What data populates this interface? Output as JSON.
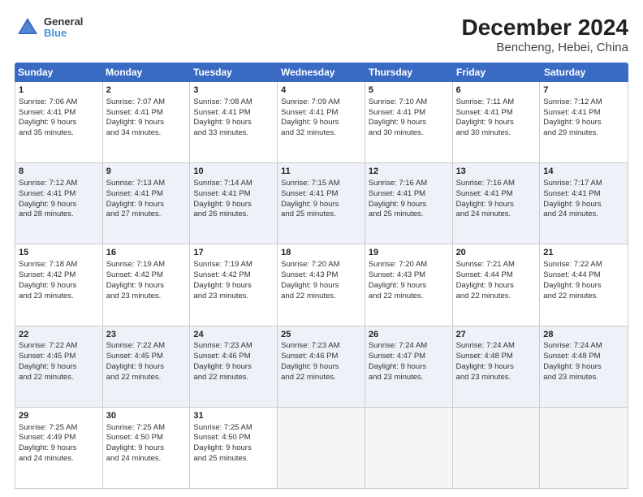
{
  "header": {
    "logo_line1": "General",
    "logo_line2": "Blue",
    "title": "December 2024",
    "subtitle": "Bencheng, Hebei, China"
  },
  "weekdays": [
    "Sunday",
    "Monday",
    "Tuesday",
    "Wednesday",
    "Thursday",
    "Friday",
    "Saturday"
  ],
  "rows": [
    [
      {
        "day": "1",
        "lines": [
          "Sunrise: 7:06 AM",
          "Sunset: 4:41 PM",
          "Daylight: 9 hours",
          "and 35 minutes."
        ]
      },
      {
        "day": "2",
        "lines": [
          "Sunrise: 7:07 AM",
          "Sunset: 4:41 PM",
          "Daylight: 9 hours",
          "and 34 minutes."
        ]
      },
      {
        "day": "3",
        "lines": [
          "Sunrise: 7:08 AM",
          "Sunset: 4:41 PM",
          "Daylight: 9 hours",
          "and 33 minutes."
        ]
      },
      {
        "day": "4",
        "lines": [
          "Sunrise: 7:09 AM",
          "Sunset: 4:41 PM",
          "Daylight: 9 hours",
          "and 32 minutes."
        ]
      },
      {
        "day": "5",
        "lines": [
          "Sunrise: 7:10 AM",
          "Sunset: 4:41 PM",
          "Daylight: 9 hours",
          "and 30 minutes."
        ]
      },
      {
        "day": "6",
        "lines": [
          "Sunrise: 7:11 AM",
          "Sunset: 4:41 PM",
          "Daylight: 9 hours",
          "and 30 minutes."
        ]
      },
      {
        "day": "7",
        "lines": [
          "Sunrise: 7:12 AM",
          "Sunset: 4:41 PM",
          "Daylight: 9 hours",
          "and 29 minutes."
        ]
      }
    ],
    [
      {
        "day": "8",
        "lines": [
          "Sunrise: 7:12 AM",
          "Sunset: 4:41 PM",
          "Daylight: 9 hours",
          "and 28 minutes."
        ]
      },
      {
        "day": "9",
        "lines": [
          "Sunrise: 7:13 AM",
          "Sunset: 4:41 PM",
          "Daylight: 9 hours",
          "and 27 minutes."
        ]
      },
      {
        "day": "10",
        "lines": [
          "Sunrise: 7:14 AM",
          "Sunset: 4:41 PM",
          "Daylight: 9 hours",
          "and 26 minutes."
        ]
      },
      {
        "day": "11",
        "lines": [
          "Sunrise: 7:15 AM",
          "Sunset: 4:41 PM",
          "Daylight: 9 hours",
          "and 25 minutes."
        ]
      },
      {
        "day": "12",
        "lines": [
          "Sunrise: 7:16 AM",
          "Sunset: 4:41 PM",
          "Daylight: 9 hours",
          "and 25 minutes."
        ]
      },
      {
        "day": "13",
        "lines": [
          "Sunrise: 7:16 AM",
          "Sunset: 4:41 PM",
          "Daylight: 9 hours",
          "and 24 minutes."
        ]
      },
      {
        "day": "14",
        "lines": [
          "Sunrise: 7:17 AM",
          "Sunset: 4:41 PM",
          "Daylight: 9 hours",
          "and 24 minutes."
        ]
      }
    ],
    [
      {
        "day": "15",
        "lines": [
          "Sunrise: 7:18 AM",
          "Sunset: 4:42 PM",
          "Daylight: 9 hours",
          "and 23 minutes."
        ]
      },
      {
        "day": "16",
        "lines": [
          "Sunrise: 7:19 AM",
          "Sunset: 4:42 PM",
          "Daylight: 9 hours",
          "and 23 minutes."
        ]
      },
      {
        "day": "17",
        "lines": [
          "Sunrise: 7:19 AM",
          "Sunset: 4:42 PM",
          "Daylight: 9 hours",
          "and 23 minutes."
        ]
      },
      {
        "day": "18",
        "lines": [
          "Sunrise: 7:20 AM",
          "Sunset: 4:43 PM",
          "Daylight: 9 hours",
          "and 22 minutes."
        ]
      },
      {
        "day": "19",
        "lines": [
          "Sunrise: 7:20 AM",
          "Sunset: 4:43 PM",
          "Daylight: 9 hours",
          "and 22 minutes."
        ]
      },
      {
        "day": "20",
        "lines": [
          "Sunrise: 7:21 AM",
          "Sunset: 4:44 PM",
          "Daylight: 9 hours",
          "and 22 minutes."
        ]
      },
      {
        "day": "21",
        "lines": [
          "Sunrise: 7:22 AM",
          "Sunset: 4:44 PM",
          "Daylight: 9 hours",
          "and 22 minutes."
        ]
      }
    ],
    [
      {
        "day": "22",
        "lines": [
          "Sunrise: 7:22 AM",
          "Sunset: 4:45 PM",
          "Daylight: 9 hours",
          "and 22 minutes."
        ]
      },
      {
        "day": "23",
        "lines": [
          "Sunrise: 7:22 AM",
          "Sunset: 4:45 PM",
          "Daylight: 9 hours",
          "and 22 minutes."
        ]
      },
      {
        "day": "24",
        "lines": [
          "Sunrise: 7:23 AM",
          "Sunset: 4:46 PM",
          "Daylight: 9 hours",
          "and 22 minutes."
        ]
      },
      {
        "day": "25",
        "lines": [
          "Sunrise: 7:23 AM",
          "Sunset: 4:46 PM",
          "Daylight: 9 hours",
          "and 22 minutes."
        ]
      },
      {
        "day": "26",
        "lines": [
          "Sunrise: 7:24 AM",
          "Sunset: 4:47 PM",
          "Daylight: 9 hours",
          "and 23 minutes."
        ]
      },
      {
        "day": "27",
        "lines": [
          "Sunrise: 7:24 AM",
          "Sunset: 4:48 PM",
          "Daylight: 9 hours",
          "and 23 minutes."
        ]
      },
      {
        "day": "28",
        "lines": [
          "Sunrise: 7:24 AM",
          "Sunset: 4:48 PM",
          "Daylight: 9 hours",
          "and 23 minutes."
        ]
      }
    ],
    [
      {
        "day": "29",
        "lines": [
          "Sunrise: 7:25 AM",
          "Sunset: 4:49 PM",
          "Daylight: 9 hours",
          "and 24 minutes."
        ]
      },
      {
        "day": "30",
        "lines": [
          "Sunrise: 7:25 AM",
          "Sunset: 4:50 PM",
          "Daylight: 9 hours",
          "and 24 minutes."
        ]
      },
      {
        "day": "31",
        "lines": [
          "Sunrise: 7:25 AM",
          "Sunset: 4:50 PM",
          "Daylight: 9 hours",
          "and 25 minutes."
        ]
      },
      {
        "day": "",
        "lines": []
      },
      {
        "day": "",
        "lines": []
      },
      {
        "day": "",
        "lines": []
      },
      {
        "day": "",
        "lines": []
      }
    ]
  ]
}
